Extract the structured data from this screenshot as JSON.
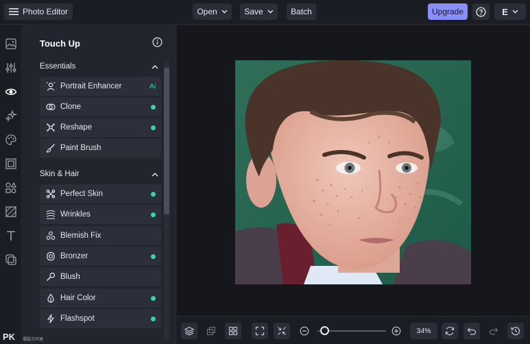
{
  "header": {
    "app_title": "Photo Editor",
    "open_label": "Open",
    "save_label": "Save",
    "batch_label": "Batch",
    "upgrade_label": "Upgrade",
    "avatar_letter": "E"
  },
  "panel": {
    "title": "Touch Up",
    "sections": [
      {
        "title": "Essentials",
        "tools": [
          {
            "label": "Portrait Enhancer",
            "badge": "Ai"
          },
          {
            "label": "Clone"
          },
          {
            "label": "Reshape"
          },
          {
            "label": "Paint Brush"
          }
        ]
      },
      {
        "title": "Skin & Hair",
        "tools": [
          {
            "label": "Perfect Skin"
          },
          {
            "label": "Wrinkles"
          },
          {
            "label": "Blemish Fix"
          },
          {
            "label": "Bronzer"
          },
          {
            "label": "Blush"
          },
          {
            "label": "Hair Color"
          },
          {
            "label": "Flashspot"
          }
        ]
      }
    ]
  },
  "zoom": {
    "percent": "34",
    "unit": "%",
    "level": 0.05
  },
  "watermark": {
    "text": "PK",
    "sub": "電腦王阿達"
  },
  "colors": {
    "accent": "#8a8ff7",
    "status_dot": "#39d3a4",
    "panel_bg": "#22252e",
    "canvas_bg": "#15171d"
  }
}
